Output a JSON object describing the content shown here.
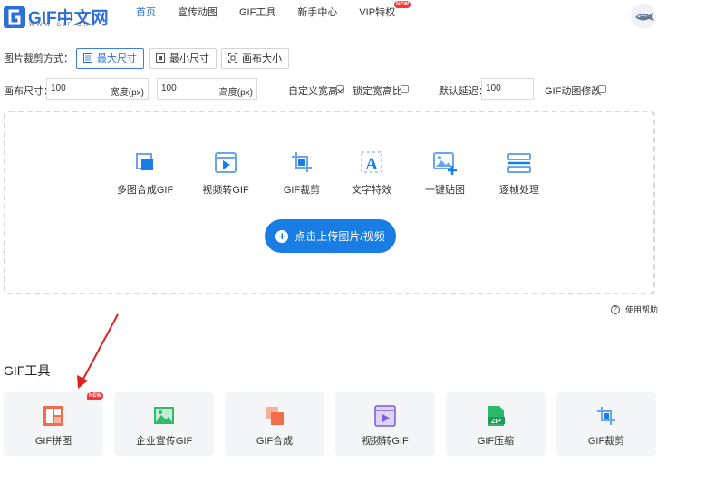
{
  "header": {
    "logo_text": "GIF中文网",
    "logo_sub": "WWW.GIF.CN",
    "nav": [
      {
        "label": "首页",
        "active": true
      },
      {
        "label": "宣传动图",
        "active": false
      },
      {
        "label": "GIF工具",
        "active": false
      },
      {
        "label": "新手中心",
        "active": false
      },
      {
        "label": "VIP特权",
        "active": false,
        "badge": "NEW"
      }
    ]
  },
  "crop": {
    "label": "图片裁剪方式：",
    "options": [
      {
        "label": "最大尺寸",
        "selected": true,
        "icon": "max-size-icon"
      },
      {
        "label": "最小尺寸",
        "selected": false,
        "icon": "min-size-icon"
      },
      {
        "label": "画布大小",
        "selected": false,
        "icon": "canvas-size-icon"
      }
    ]
  },
  "canvas": {
    "label": "画布尺寸：",
    "width_value": "100",
    "width_unit": "宽度(px)",
    "height_value": "100",
    "height_unit": "高度(px)",
    "custom_label": "自定义宽高",
    "custom_checked": true,
    "lock_label": "锁定宽高比",
    "lock_checked": false,
    "delay_label": "默认延迟：",
    "delay_value": "100",
    "modify_label": "GIF动图修改",
    "modify_checked": false
  },
  "upload": {
    "tools": [
      {
        "label": "多图合成GIF",
        "icon": "multi-image-icon"
      },
      {
        "label": "视频转GIF",
        "icon": "video-icon"
      },
      {
        "label": "GIF裁剪",
        "icon": "crop-icon"
      },
      {
        "label": "文字特效",
        "icon": "text-icon"
      },
      {
        "label": "一键贴图",
        "icon": "add-image-icon"
      },
      {
        "label": "逐帧处理",
        "icon": "frames-icon"
      }
    ],
    "button_label": "点击上传图片/视频",
    "help_label": "使用帮助"
  },
  "tools_section": {
    "title": "GIF工具",
    "cards": [
      {
        "label": "GIF拼图",
        "icon": "collage-icon",
        "badge": "NEW"
      },
      {
        "label": "企业宣传GIF",
        "icon": "picture-icon"
      },
      {
        "label": "GIF合成",
        "icon": "merge-icon"
      },
      {
        "label": "视频转GIF",
        "icon": "video-icon"
      },
      {
        "label": "GIF压缩",
        "icon": "zip-icon"
      },
      {
        "label": "GIF裁剪",
        "icon": "crop-icon"
      }
    ]
  },
  "colors": {
    "accent": "#2d6fd6",
    "button": "#1a7de3",
    "badge": "#ff3333",
    "arrow": "#e02020"
  }
}
